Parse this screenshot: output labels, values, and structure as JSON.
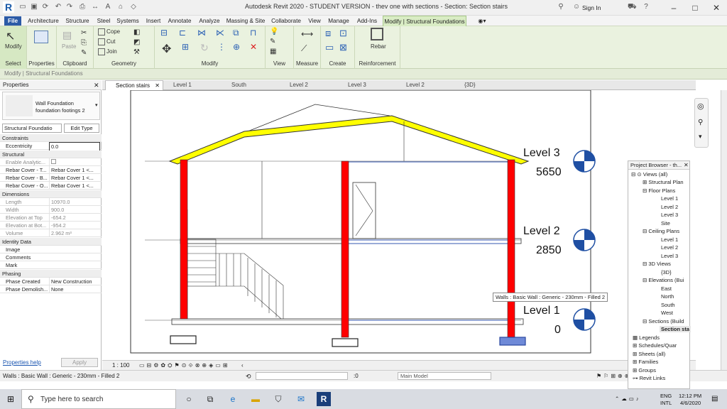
{
  "title": "Autodesk Revit 2020 - STUDENT VERSION - thev one with sections - Section: Section stairs",
  "sign_in": "Sign In",
  "tabs": {
    "file": "File",
    "t1": "Architecture",
    "t2": "Structure",
    "t3": "Steel",
    "t4": "Systems",
    "t5": "Insert",
    "t6": "Annotate",
    "t7": "Analyze",
    "t8": "Massing & Site",
    "t9": "Collaborate",
    "t10": "View",
    "t11": "Manage",
    "t12": "Add-Ins",
    "t13": "Modify | Structural Foundations"
  },
  "ribbon": {
    "modify": "Modify",
    "select": "Select",
    "properties": "Properties",
    "paste": "Paste",
    "clipboard": "Clipboard",
    "cope": "Cope",
    "cut": "Cut",
    "join": "Join",
    "geometry": "Geometry",
    "modify_grp": "Modify",
    "view": "View",
    "measure": "Measure",
    "create": "Create",
    "rebar": "Rebar",
    "reinforcement": "Reinforcement"
  },
  "context_label": "Modify | Structural Foundations",
  "props": {
    "header": "Properties",
    "type_name": "Wall Foundation",
    "type_sub": "foundation footings 2",
    "filter": "Structural Foundatio",
    "edit_type": "Edit Type",
    "constraints": "Constraints",
    "eccentricity_k": "Eccentricity",
    "eccentricity_v": "0.0",
    "structural": "Structural",
    "enable_k": "Enable Analytic...",
    "rc_top_k": "Rebar Cover - T...",
    "rc_top_v": "Rebar Cover 1 <...",
    "rc_bot_k": "Rebar Cover - B...",
    "rc_bot_v": "Rebar Cover 1 <...",
    "rc_oth_k": "Rebar Cover - O...",
    "rc_oth_v": "Rebar Cover 1 <...",
    "dimensions": "Dimensions",
    "length_k": "Length",
    "length_v": "10970.0",
    "width_k": "Width",
    "width_v": "900.0",
    "elt_k": "Elevation at Top",
    "elt_v": "-654.2",
    "elb_k": "Elevation at Bot...",
    "elb_v": "-954.2",
    "vol_k": "Volume",
    "vol_v": "2.962 m³",
    "identity": "Identity Data",
    "image_k": "Image",
    "comments_k": "Comments",
    "mark_k": "Mark",
    "phasing": "Phasing",
    "pc_k": "Phase Created",
    "pc_v": "New Construction",
    "pd_k": "Phase Demolish...",
    "pd_v": "None",
    "help": "Properties help",
    "apply": "Apply"
  },
  "view_tabs": {
    "v0": "Section stairs",
    "v1": "Level 1",
    "v2": "South",
    "v3": "Level 2",
    "v4": "Level 3",
    "v5": "Level 2",
    "v6": "{3D}"
  },
  "levels": {
    "l3_name": "Level 3",
    "l3_elev": "5650",
    "l2_name": "Level 2",
    "l2_elev": "2850",
    "l1_name": "Level 1",
    "l1_elev": "0"
  },
  "tooltip": "Walls : Basic Wall : Generic - 230mm - Filled 2",
  "viewbar": {
    "scale": "1 : 100",
    "main_model": "Main Model",
    "zero": ":0"
  },
  "status": "Walls : Basic Wall : Generic - 230mm - Filled 2",
  "pb": {
    "header": "Project Browser - th...",
    "views": "Views (all)",
    "sp": "Structural Plan",
    "fp": "Floor Plans",
    "fp1": "Level 1",
    "fp2": "Level 2",
    "fp3": "Level 3",
    "site": "Site",
    "cp": "Ceiling Plans",
    "cp1": "Level 1",
    "cp2": "Level 2",
    "cp3": "Level 3",
    "v3d": "3D Views",
    "v3d1": "{3D}",
    "elev": "Elevations (Bui",
    "east": "East",
    "north": "North",
    "south": "South",
    "west": "West",
    "sections": "Sections (Build",
    "sec1": "Section sta",
    "legends": "Legends",
    "sched": "Schedules/Quar",
    "sheets": "Sheets (all)",
    "families": "Families",
    "groups": "Groups",
    "links": "Revit Links"
  },
  "taskbar": {
    "search": "Type here to search",
    "lang1": "ENG",
    "lang2": "INTL",
    "time": "12:12 PM",
    "date": "4/6/2020"
  },
  "colors": {
    "ribbon_bg": "#eaf2df",
    "wall_red": "#ff0000",
    "roof_yellow": "#ffff00",
    "level_blue": "#1f4fa3"
  }
}
